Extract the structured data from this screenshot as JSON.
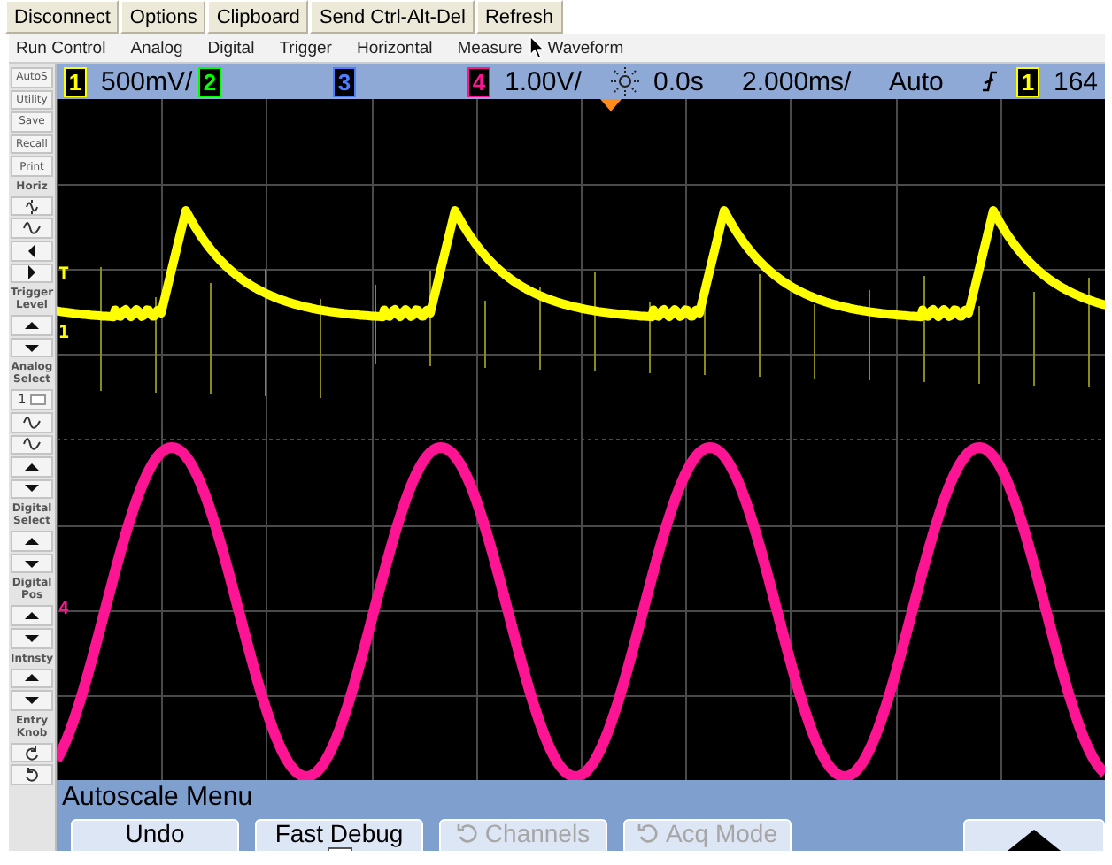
{
  "toolbar": {
    "buttons": [
      "Disconnect",
      "Options",
      "Clipboard",
      "Send Ctrl-Alt-Del",
      "Refresh"
    ]
  },
  "menu_bar": {
    "items": [
      "Run Control",
      "Analog",
      "Digital",
      "Trigger",
      "Horizontal",
      "Measure",
      "Waveform"
    ]
  },
  "side_panel": {
    "items": [
      {
        "kind": "button",
        "label": "AutoS"
      },
      {
        "kind": "button",
        "label": "Utility"
      },
      {
        "kind": "button",
        "label": "Save"
      },
      {
        "kind": "button",
        "label": "Recall"
      },
      {
        "kind": "button",
        "label": "Print"
      },
      {
        "kind": "heading",
        "label": "Horiz"
      },
      {
        "kind": "zoomwave"
      },
      {
        "kind": "wave"
      },
      {
        "kind": "left"
      },
      {
        "kind": "right"
      },
      {
        "kind": "heading",
        "label": "Trigger Level"
      },
      {
        "kind": "up"
      },
      {
        "kind": "down"
      },
      {
        "kind": "heading",
        "label": "Analog Select"
      },
      {
        "kind": "select",
        "label": "1"
      },
      {
        "kind": "wave"
      },
      {
        "kind": "wave"
      },
      {
        "kind": "up"
      },
      {
        "kind": "down"
      },
      {
        "kind": "heading",
        "label": "Digital Select"
      },
      {
        "kind": "up"
      },
      {
        "kind": "down"
      },
      {
        "kind": "heading",
        "label": "Digital Pos"
      },
      {
        "kind": "up"
      },
      {
        "kind": "down"
      },
      {
        "kind": "heading",
        "label": "Intnsty"
      },
      {
        "kind": "up"
      },
      {
        "kind": "down"
      },
      {
        "kind": "heading",
        "label": "Entry Knob"
      },
      {
        "kind": "ccw"
      },
      {
        "kind": "cw"
      }
    ]
  },
  "status_bar": {
    "channels": [
      {
        "label": "1",
        "color": "#ffff00",
        "scale": "500mV/"
      },
      {
        "label": "2",
        "color": "#00ff00"
      },
      {
        "label": "3",
        "color": "#4f7dff"
      },
      {
        "label": "4",
        "color": "#ff1493",
        "scale": "1.00V/"
      }
    ],
    "time_offset": "0.0s",
    "timebase": "2.000ms/",
    "trigger_mode": "Auto",
    "trigger_source": "1",
    "trigger_level": "164"
  },
  "display": {
    "markers": [
      {
        "label": "T",
        "color": "#ffff00"
      },
      {
        "label": "1",
        "color": "#ffff00"
      },
      {
        "label": "4",
        "color": "#ff1493"
      }
    ]
  },
  "softkey_menu": {
    "title": "Autoscale Menu",
    "softkeys": [
      {
        "kind": "plain",
        "label": "Undo",
        "disabled": false
      },
      {
        "kind": "checkbox",
        "label": "Fast Debug",
        "checked": false,
        "disabled": false
      },
      {
        "kind": "cycle",
        "label": "Channels",
        "disabled": true
      },
      {
        "kind": "cycle",
        "label": "Acq Mode",
        "disabled": true
      },
      {
        "kind": "arrow"
      }
    ]
  }
}
